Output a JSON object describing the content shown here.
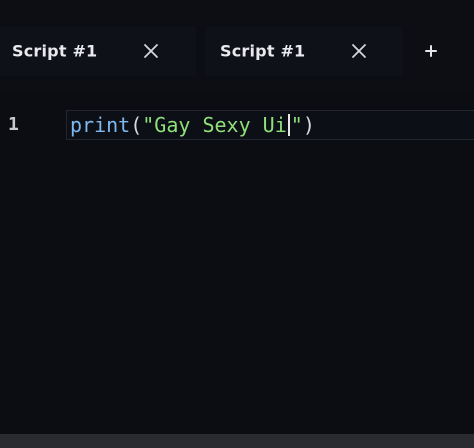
{
  "tabs": [
    {
      "label": "Script #1"
    },
    {
      "label": "Script #1"
    }
  ],
  "add_tab_label": "+",
  "editor": {
    "lines": [
      {
        "number": "1",
        "tokens": {
          "fn": "print",
          "open": "(",
          "string_open": "\"Gay Sexy Ui",
          "string_close": "\"",
          "close": ")"
        }
      }
    ]
  },
  "colors": {
    "background": "#0b0d13",
    "function": "#7fb8ee",
    "string": "#8fe07a",
    "text": "#e9e9ee"
  },
  "icons": {
    "tab_close": "close-icon",
    "add_tab": "plus-icon"
  }
}
